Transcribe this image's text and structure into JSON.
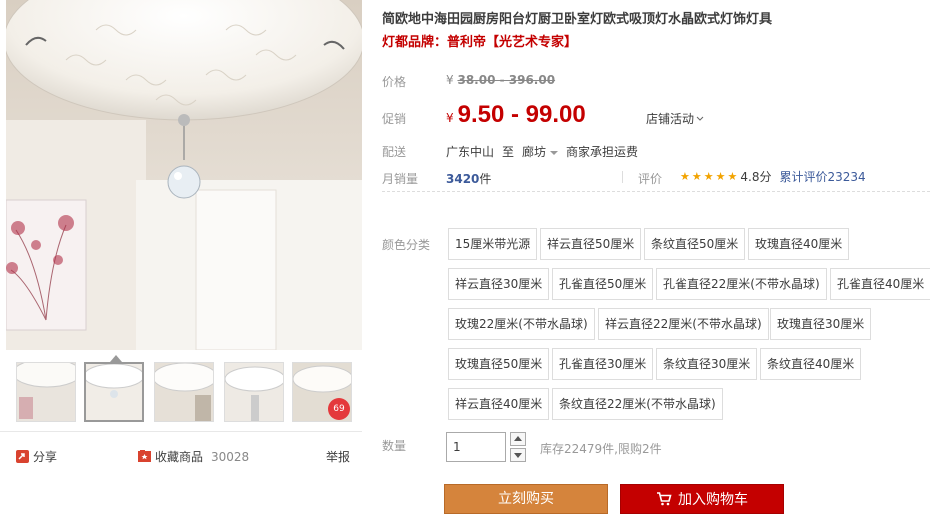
{
  "product": {
    "title": "简欧地中海田园厨房阳台灯厨卫卧室灯欧式吸顶灯水晶欧式灯饰灯具",
    "subtitle": "灯都品牌：普利帝【光艺术专家】"
  },
  "price": {
    "label": "价格",
    "currency": "¥",
    "original": "38.00 - 396.00"
  },
  "promo": {
    "label": "促销",
    "currency": "¥",
    "price": "9.50 - 99.00",
    "store_event": "店铺活动"
  },
  "shipping": {
    "label": "配送",
    "from": "广东中山",
    "to_word": "至",
    "to": "廊坊",
    "fee": "商家承担运费"
  },
  "sales": {
    "label": "月销量",
    "count": "3420",
    "unit": "件",
    "rating_label": "评价",
    "rating": "4.8分",
    "reviews": "累计评价23234"
  },
  "options": {
    "label": "颜色分类",
    "items": [
      "15厘米带光源",
      "祥云直径50厘米",
      "条纹直径50厘米",
      "玫瑰直径40厘米",
      "祥云直径30厘米",
      "孔雀直径50厘米",
      "孔雀直径22厘米(不带水晶球)",
      "孔雀直径40厘米",
      "玫瑰22厘米(不带水晶球)",
      "祥云直径22厘米(不带水晶球)",
      "玫瑰直径30厘米",
      "玫瑰直径50厘米",
      "孔雀直径30厘米",
      "条纹直径30厘米",
      "条纹直径40厘米",
      "祥云直径40厘米",
      "条纹直径22厘米(不带水晶球)"
    ]
  },
  "quantity": {
    "label": "数量",
    "value": "1",
    "stock": "库存22479件,限购2件"
  },
  "buttons": {
    "buy": "立刻购买",
    "cart": "加入购物车"
  },
  "gallery": {
    "discount_badge": "69",
    "share": "分享",
    "favorite": "收藏商品",
    "favorite_count": "30028",
    "report": "举报"
  },
  "colors": {
    "accent_red": "#c40000",
    "buy_orange": "#d5843c",
    "link_blue": "#3c5a9a"
  }
}
